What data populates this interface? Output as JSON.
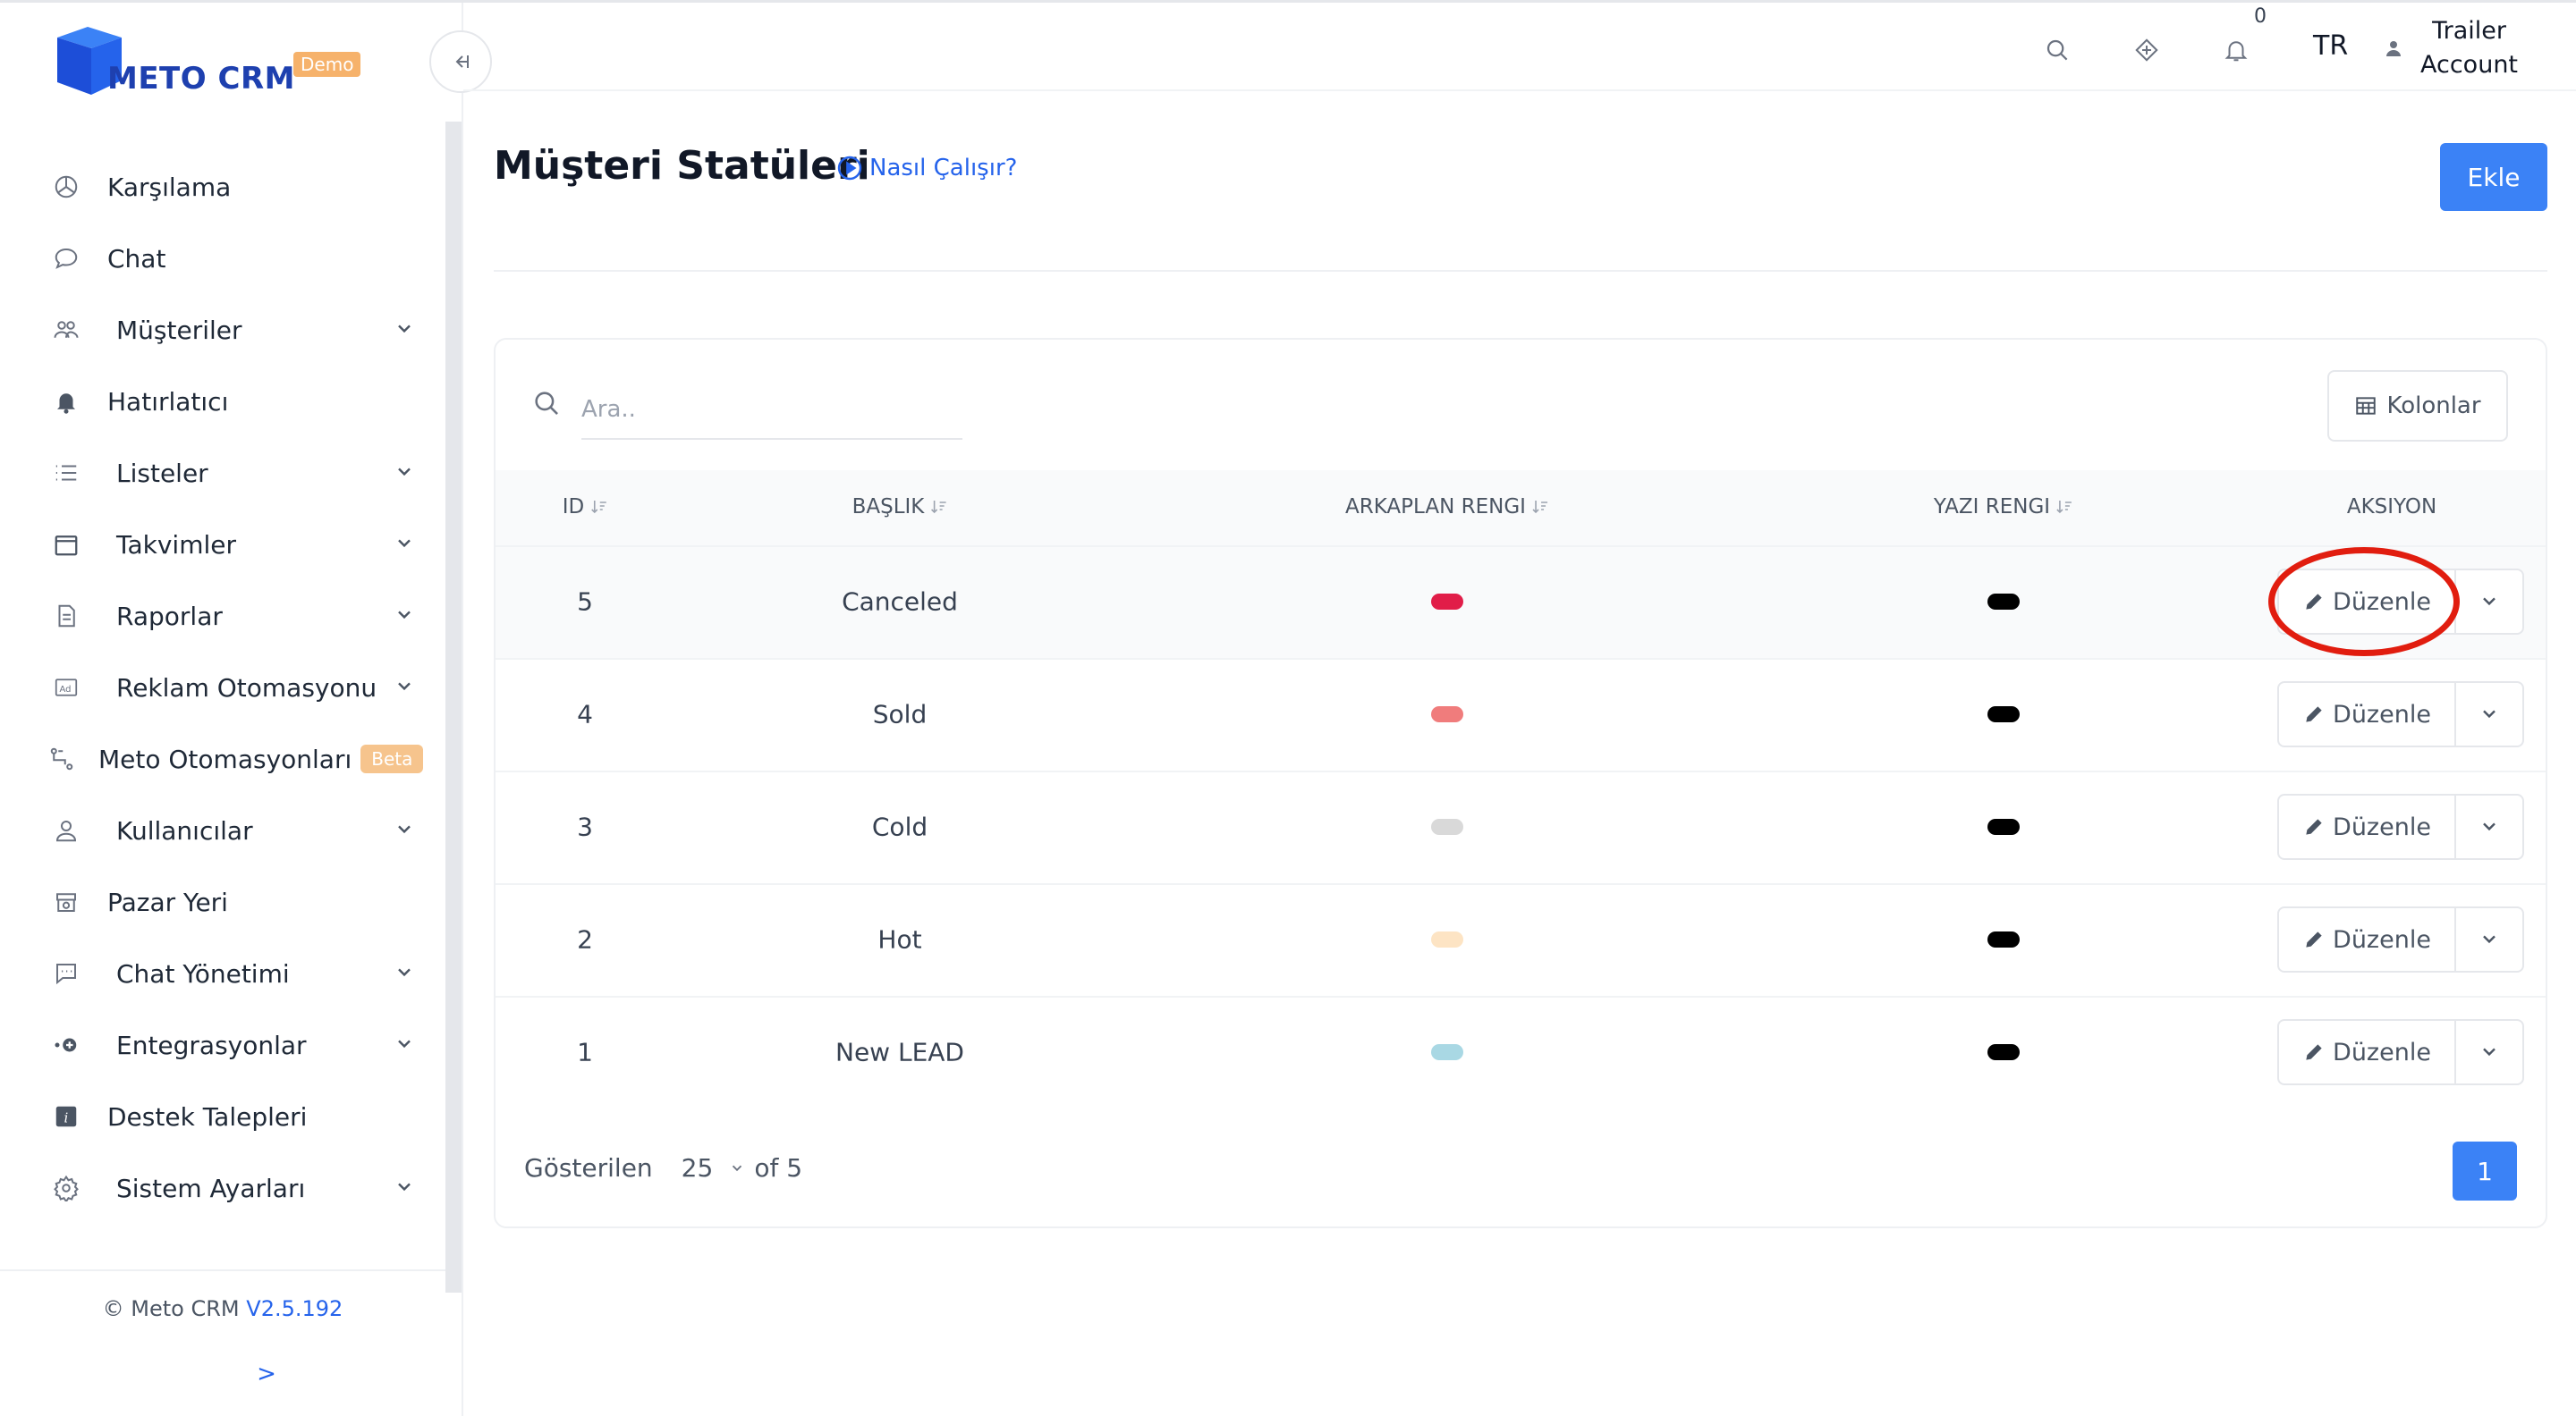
{
  "brand": {
    "name": "METO CRM",
    "badge": "Demo",
    "color": "#1e40af"
  },
  "sidebar": {
    "collapse_icon": "collapse-left-icon",
    "items": [
      {
        "label": "Karşılama",
        "icon": "dashboard-icon",
        "has_children": false
      },
      {
        "label": "Chat",
        "icon": "chat-bubble-icon",
        "has_children": false
      },
      {
        "label": "Müşteriler",
        "icon": "users-icon",
        "has_children": true
      },
      {
        "label": "Hatırlatıcı",
        "icon": "bell-icon",
        "has_children": false
      },
      {
        "label": "Listeler",
        "icon": "list-icon",
        "has_children": true
      },
      {
        "label": "Takvimler",
        "icon": "calendar-icon",
        "has_children": true
      },
      {
        "label": "Raporlar",
        "icon": "report-icon",
        "has_children": true
      },
      {
        "label": "Reklam Otomasyonu",
        "icon": "ad-icon",
        "has_children": true
      },
      {
        "label": "Meto Otomasyonları",
        "icon": "automation-icon",
        "has_children": false,
        "badge": "Beta"
      },
      {
        "label": "Kullanıcılar",
        "icon": "user-icon",
        "has_children": true
      },
      {
        "label": "Pazar Yeri",
        "icon": "marketplace-icon",
        "has_children": false
      },
      {
        "label": "Chat Yönetimi",
        "icon": "chat-settings-icon",
        "has_children": true
      },
      {
        "label": "Entegrasyonlar",
        "icon": "integration-icon",
        "has_children": true
      },
      {
        "label": "Destek Talepleri",
        "icon": "info-icon",
        "has_children": false
      },
      {
        "label": "Sistem Ayarları",
        "icon": "gear-icon",
        "has_children": true
      }
    ],
    "footer": {
      "copyright": "© Meto CRM",
      "version": "V2.5.192",
      "expand": ">"
    }
  },
  "header": {
    "icons": [
      "search-icon",
      "diamond-icon",
      "bell-icon"
    ],
    "notification_count": "0",
    "language": "TR",
    "account_line1": "Trailer",
    "account_line2": "Account"
  },
  "page": {
    "title": "Müşteri Statüleri",
    "how_link": "Nasıl Çalışır?",
    "add_button": "Ekle"
  },
  "table": {
    "search_placeholder": "Ara..",
    "columns_button": "Kolonlar",
    "headers": {
      "id": "ID",
      "title": "BAŞLIK",
      "bg_color": "ARKAPLAN RENGI",
      "text_color": "YAZI RENGI",
      "action": "AKSIYON"
    },
    "rows": [
      {
        "id": "5",
        "title": "Canceled",
        "bg_color": "#e11d48",
        "text_color": "#000000",
        "action": "Düzenle"
      },
      {
        "id": "4",
        "title": "Sold",
        "bg_color": "#f07c7c",
        "text_color": "#000000",
        "action": "Düzenle"
      },
      {
        "id": "3",
        "title": "Cold",
        "bg_color": "#d9d9d9",
        "text_color": "#000000",
        "action": "Düzenle"
      },
      {
        "id": "2",
        "title": "Hot",
        "bg_color": "#fde4c4",
        "text_color": "#000000",
        "action": "Düzenle"
      },
      {
        "id": "1",
        "title": "New LEAD",
        "bg_color": "#a9d8e4",
        "text_color": "#000000",
        "action": "Düzenle"
      }
    ],
    "highlighted_row": 0,
    "pagination": {
      "shown_label": "Gösterilen",
      "page_size": "25",
      "of_label": "of 5",
      "current_page": "1"
    }
  },
  "colors": {
    "accent": "#3b82f6",
    "annotation": "#e11d0f"
  }
}
